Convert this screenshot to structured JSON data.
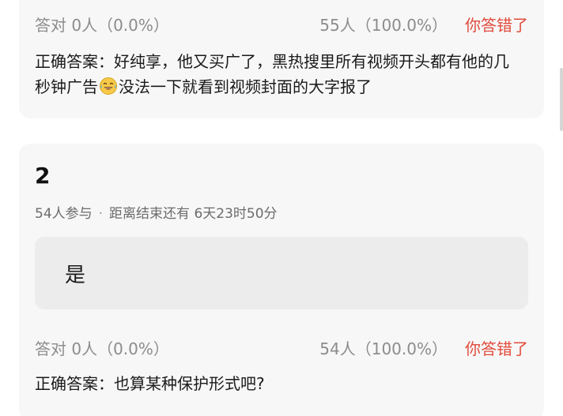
{
  "colors": {
    "card_bg": "#f7f7f7",
    "option_bg": "#ececec",
    "wrong_red": "#e14b3c",
    "muted_gray": "#8c8c8c"
  },
  "question1": {
    "stat_correct": "答对  0人（0.0%）",
    "stat_count": "55人（100.0%）",
    "stat_result": "你答错了",
    "answer_part1": "正确答案：好纯享，他又买广了，黑热搜里所有视频开头都有他的几秒钟广告",
    "emoji_icon": "laughing-tears-emoji-icon",
    "answer_part2": "没法一下就看到视频封面的大字报了"
  },
  "question2": {
    "number": "2",
    "participants": "54人参与",
    "deadline": "距离结束还有 6天23时50分",
    "option_text": "是",
    "stat_correct": "答对  0人（0.0%）",
    "stat_count": "54人（100.0%）",
    "stat_result": "你答错了",
    "answer": "正确答案：也算某种保护形式吧?"
  }
}
